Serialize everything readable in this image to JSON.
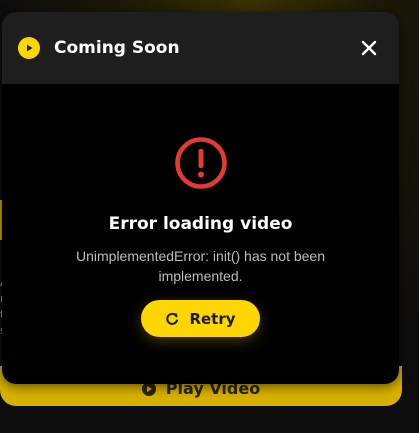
{
  "dialog": {
    "title": "Coming Soon",
    "header_icon": "play-circle-icon",
    "close_icon": "close-icon"
  },
  "error": {
    "icon": "error-circle-icon",
    "title": "Error loading video",
    "message": "UnimplementedError: init() has not been implemented.",
    "retry_label": "Retry",
    "retry_icon": "refresh-icon"
  },
  "background": {
    "play_video_label": "Play Video",
    "play_icon": "play-circle-icon"
  },
  "colors": {
    "accent": "#ffd600",
    "error": "#e53935",
    "dialog_bg": "#000000",
    "header_bg": "#1e1e1e"
  }
}
